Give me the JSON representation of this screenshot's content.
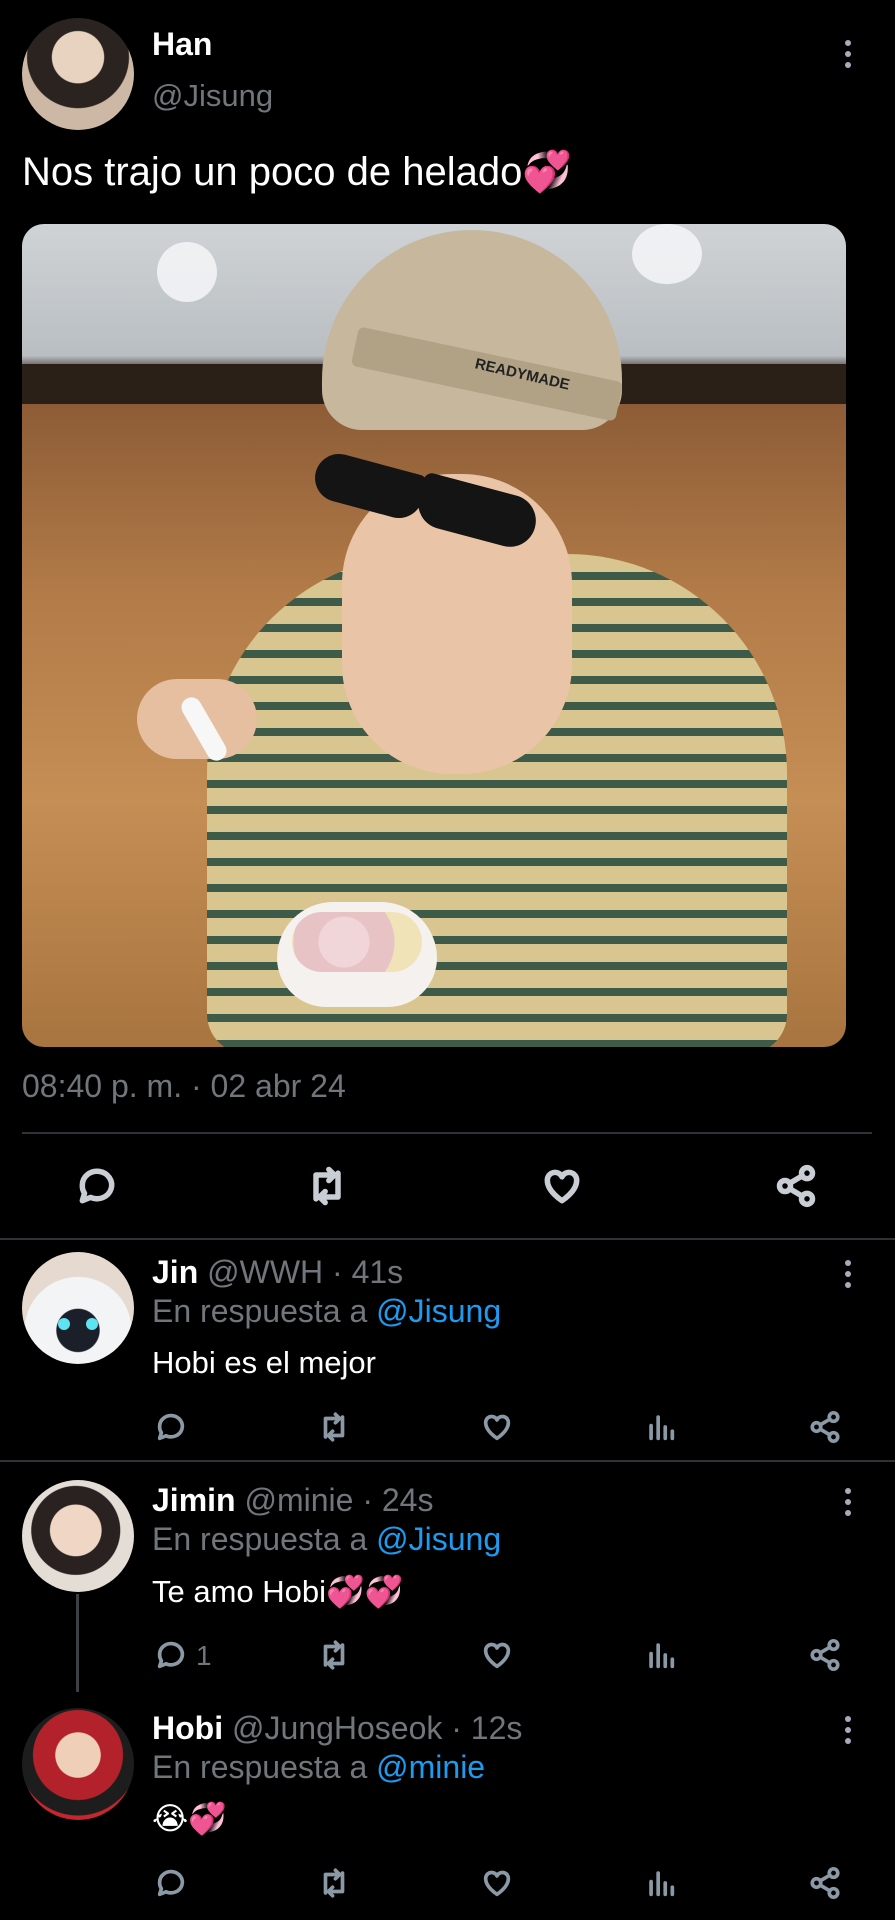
{
  "main_tweet": {
    "author_name": "Han",
    "author_handle": "@Jisung",
    "text": "Nos trajo un poco de helado",
    "text_emoji": "💞",
    "timestamp": "08:40 p. m. · 02 abr 24",
    "photo_text": "READYMADE"
  },
  "replies": [
    {
      "name": "Jin",
      "handle": "@WWH",
      "time": "· 41s",
      "reply_prefix": "En respuesta a",
      "reply_to": "@Jisung",
      "text": "Hobi es el mejor",
      "reply_count": ""
    },
    {
      "name": "Jimin",
      "handle": "@minie",
      "time": "· 24s",
      "reply_prefix": "En respuesta a",
      "reply_to": "@Jisung",
      "text": "Te amo Hobi",
      "text_emoji": "💞💞",
      "reply_count": "1"
    },
    {
      "name": "Hobi",
      "handle": "@JungHoseok",
      "time": "· 12s",
      "reply_prefix": "En respuesta a",
      "reply_to": "@minie",
      "text": "",
      "text_emoji": "😭💞",
      "reply_count": ""
    }
  ],
  "icons": [
    "reply-icon",
    "retweet-icon",
    "like-icon",
    "share-icon",
    "views-icon",
    "more-icon"
  ],
  "colors": {
    "background": "#000000",
    "link": "#1d9bf0",
    "secondary_text": "#71767b",
    "divider": "#2f3336"
  }
}
